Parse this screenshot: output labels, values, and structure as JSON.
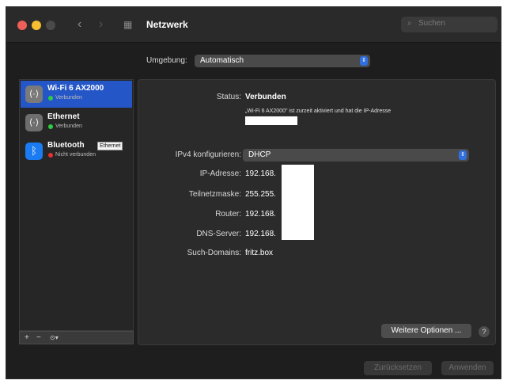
{
  "window": {
    "title": "Netzwerk",
    "search_placeholder": "Suchen"
  },
  "location": {
    "label": "Umgebung:",
    "value": "Automatisch"
  },
  "sidebar": {
    "items": [
      {
        "name": "Wi-Fi 6 AX2000",
        "status": "Verbunden",
        "status_color": "#2ecc40",
        "icon": "wifi-adapter-icon",
        "selected": true
      },
      {
        "name": "Ethernet",
        "status": "Verbunden",
        "status_color": "#2ecc40",
        "icon": "ethernet-icon",
        "selected": false
      },
      {
        "name": "Bluetooth",
        "status": "Nicht verbunden",
        "status_color": "#e8302f",
        "icon": "bluetooth-icon",
        "selected": false
      }
    ],
    "tooltip": "Ethernet",
    "buttons": {
      "add": "+",
      "remove": "−",
      "action": "⊙▾"
    }
  },
  "detail": {
    "status_label": "Status:",
    "status_value": "Verbunden",
    "status_description": "„Wi-Fi 6 AX2000\" ist zurzeit aktiviert und hat die IP-Adresse",
    "ipv4_label": "IPv4 konfigurieren:",
    "ipv4_value": "DHCP",
    "ip_label": "IP-Adresse:",
    "ip_value": "192.168.",
    "subnet_label": "Teilnetzmaske:",
    "subnet_value": "255.255.",
    "router_label": "Router:",
    "router_value": "192.168.",
    "dns_label": "DNS-Server:",
    "dns_value": "192.168.",
    "search_domains_label": "Such-Domains:",
    "search_domains_value": "fritz.box",
    "advanced_button": "Weitere Optionen ...",
    "help": "?"
  },
  "footer": {
    "revert_button": "Zurücksetzen",
    "apply_button": "Anwenden"
  },
  "colors": {
    "accent": "#2f6fe0",
    "selection": "#2456c7",
    "connected": "#2ecc40",
    "disconnected": "#e8302f"
  }
}
